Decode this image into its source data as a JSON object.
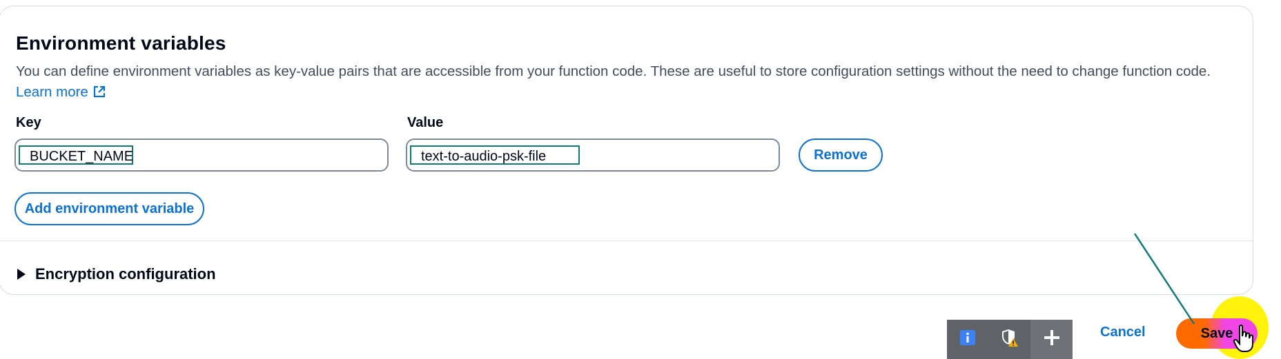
{
  "section": {
    "title": "Environment variables",
    "description": "You can define environment variables as key-value pairs that are accessible from your function code. These are useful to store configuration settings without the need to change function code.",
    "learn_more": "Learn more"
  },
  "form": {
    "key_label": "Key",
    "value_label": "Value",
    "key_value": "BUCKET_NAME",
    "value_value": "text-to-audio-psk-file",
    "remove_label": "Remove",
    "add_label": "Add environment variable"
  },
  "encryption": {
    "label": "Encryption configuration"
  },
  "footer": {
    "cancel_label": "Cancel",
    "save_label": "Save"
  },
  "toolbar": {
    "icons": [
      "info-icon",
      "shield-warning-icon",
      "plus-icon"
    ]
  },
  "colors": {
    "accent": "#0972d3",
    "highlight": "#fff200",
    "annotation": "#0f7b76",
    "save_gradient": [
      "#ff6a00",
      "#f046e6"
    ]
  }
}
